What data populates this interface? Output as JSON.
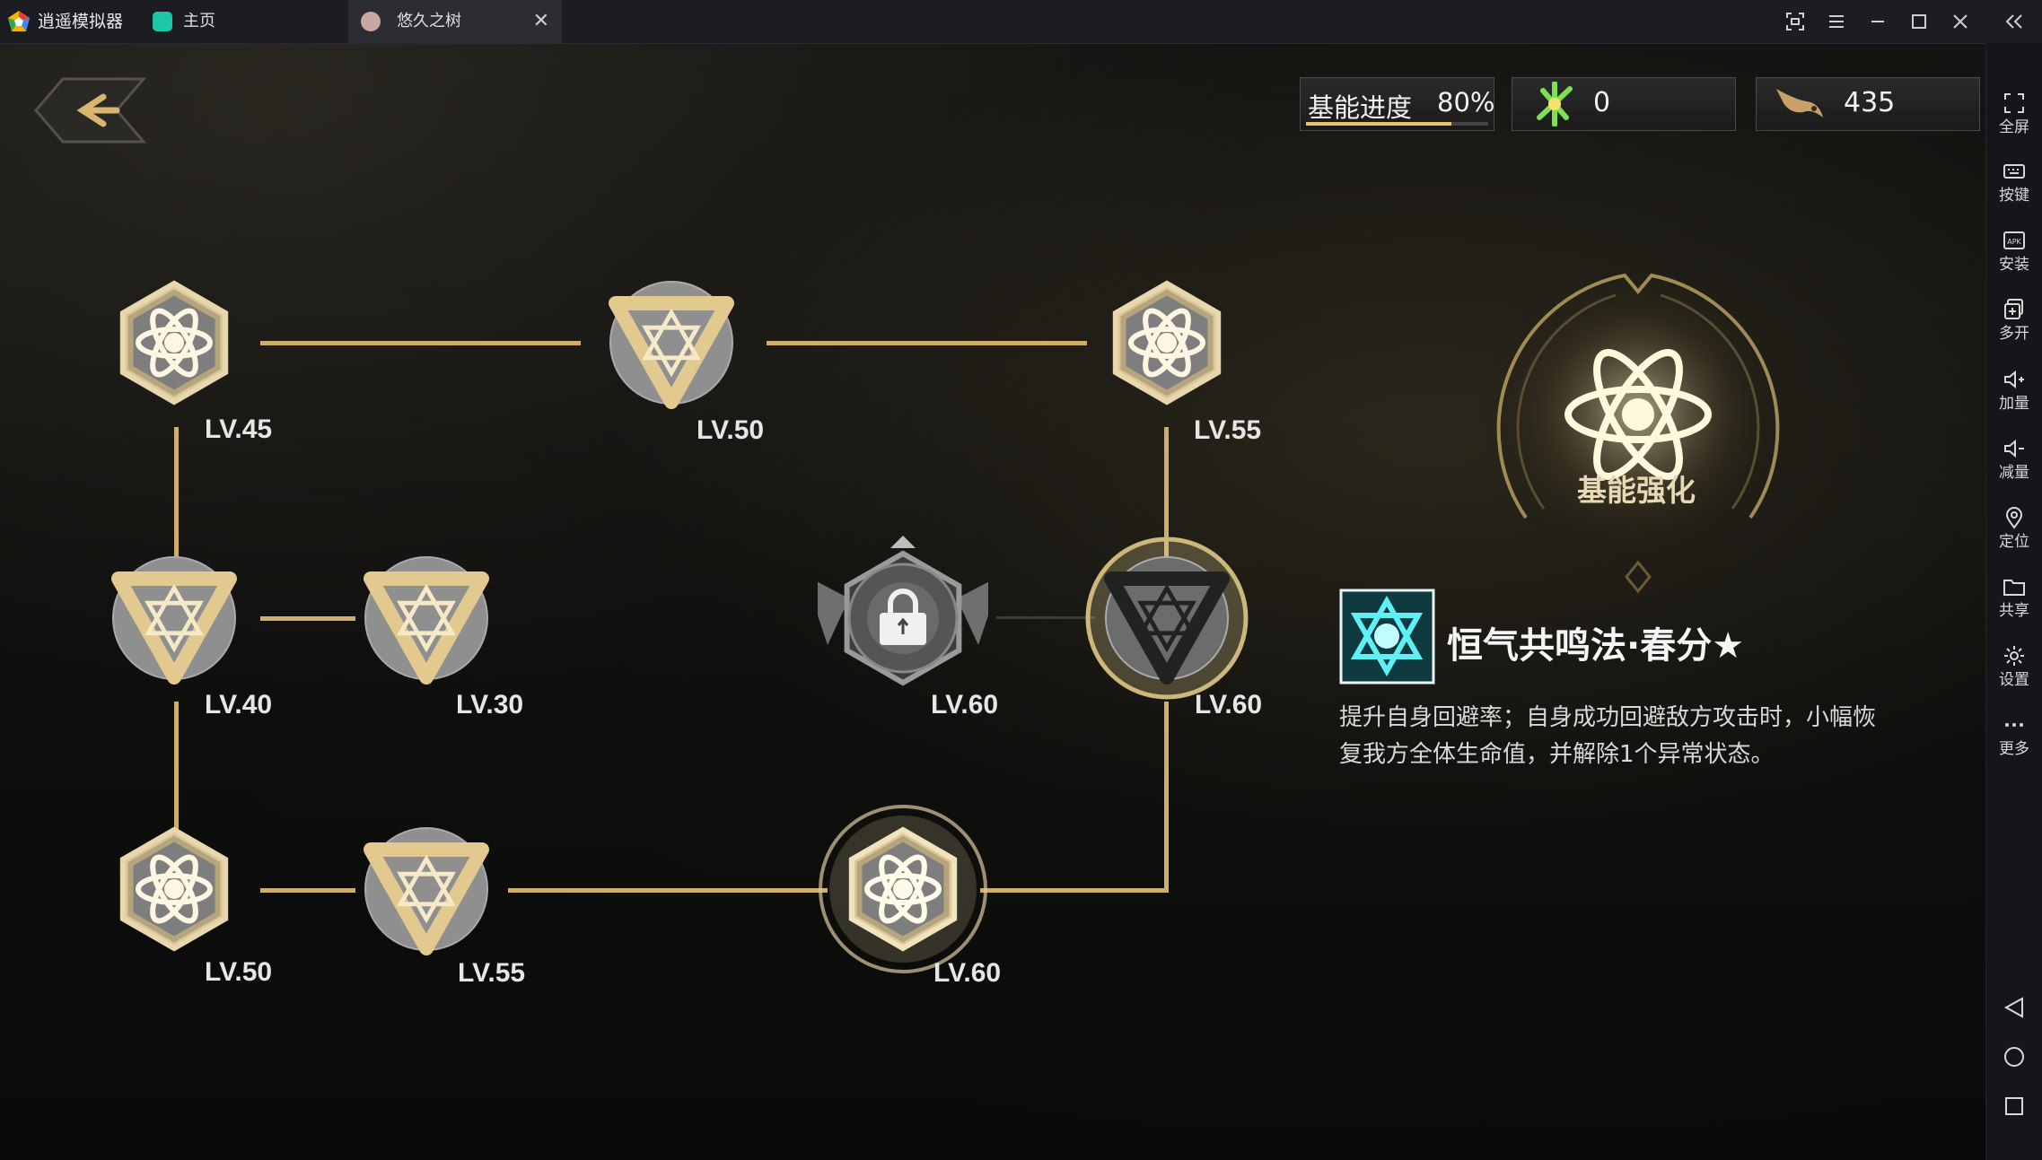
{
  "titlebar": {
    "app_name": "逍遥模拟器",
    "tabs": [
      {
        "label": "主页",
        "active": false
      },
      {
        "label": "悠久之树",
        "active": true
      }
    ],
    "close_tab_glyph": "✕",
    "window_buttons": [
      "screenshot-icon",
      "menu-icon",
      "minimize-icon",
      "maximize-icon",
      "close-icon",
      "collapse-icon"
    ]
  },
  "sidebar": {
    "items": [
      {
        "label": "全屏",
        "icon": "fullscreen-icon"
      },
      {
        "label": "按键",
        "icon": "keyboard-icon"
      },
      {
        "label": "安装",
        "icon": "apk-install-icon"
      },
      {
        "label": "多开",
        "icon": "multi-instance-icon"
      },
      {
        "label": "加量",
        "icon": "volume-up-icon"
      },
      {
        "label": "减量",
        "icon": "volume-down-icon"
      },
      {
        "label": "定位",
        "icon": "location-icon"
      },
      {
        "label": "共享",
        "icon": "folder-share-icon"
      },
      {
        "label": "设置",
        "icon": "gear-icon"
      },
      {
        "label": "更多",
        "icon": "more-icon"
      }
    ],
    "nav": [
      "back-triangle-icon",
      "home-circle-icon",
      "recent-square-icon"
    ]
  },
  "hud": {
    "progress_label": "基能进度",
    "progress_value": "80%",
    "progress_fraction": 0.8,
    "currency1_value": "0",
    "currency2_value": "435"
  },
  "nodes": [
    {
      "id": "n1",
      "level": "LV.45",
      "shape": "hex"
    },
    {
      "id": "n2",
      "level": "LV.50",
      "shape": "tri"
    },
    {
      "id": "n3",
      "level": "LV.55",
      "shape": "hex"
    },
    {
      "id": "n4",
      "level": "LV.40",
      "shape": "tri"
    },
    {
      "id": "n5",
      "level": "LV.30",
      "shape": "tri"
    },
    {
      "id": "n6",
      "level": "LV.60",
      "shape": "locked"
    },
    {
      "id": "n7",
      "level": "LV.60",
      "shape": "tri-selected"
    },
    {
      "id": "n8",
      "level": "LV.50",
      "shape": "hex"
    },
    {
      "id": "n9",
      "level": "LV.55",
      "shape": "tri"
    },
    {
      "id": "n10",
      "level": "LV.60",
      "shape": "hex-glow"
    }
  ],
  "detail": {
    "emblem_label": "基能强化",
    "skill_title": "恒气共鸣法·春分★",
    "desc_line1": "提升自身回避率；自身成功回避敌方攻击时，小幅恢",
    "desc_line2": "复我方全体生命值，并解除1个异常状态。"
  },
  "colors": {
    "gold": "#cfae6c",
    "node_gray": "#8a8a8a",
    "skill_cyan": "#39d6e0"
  }
}
